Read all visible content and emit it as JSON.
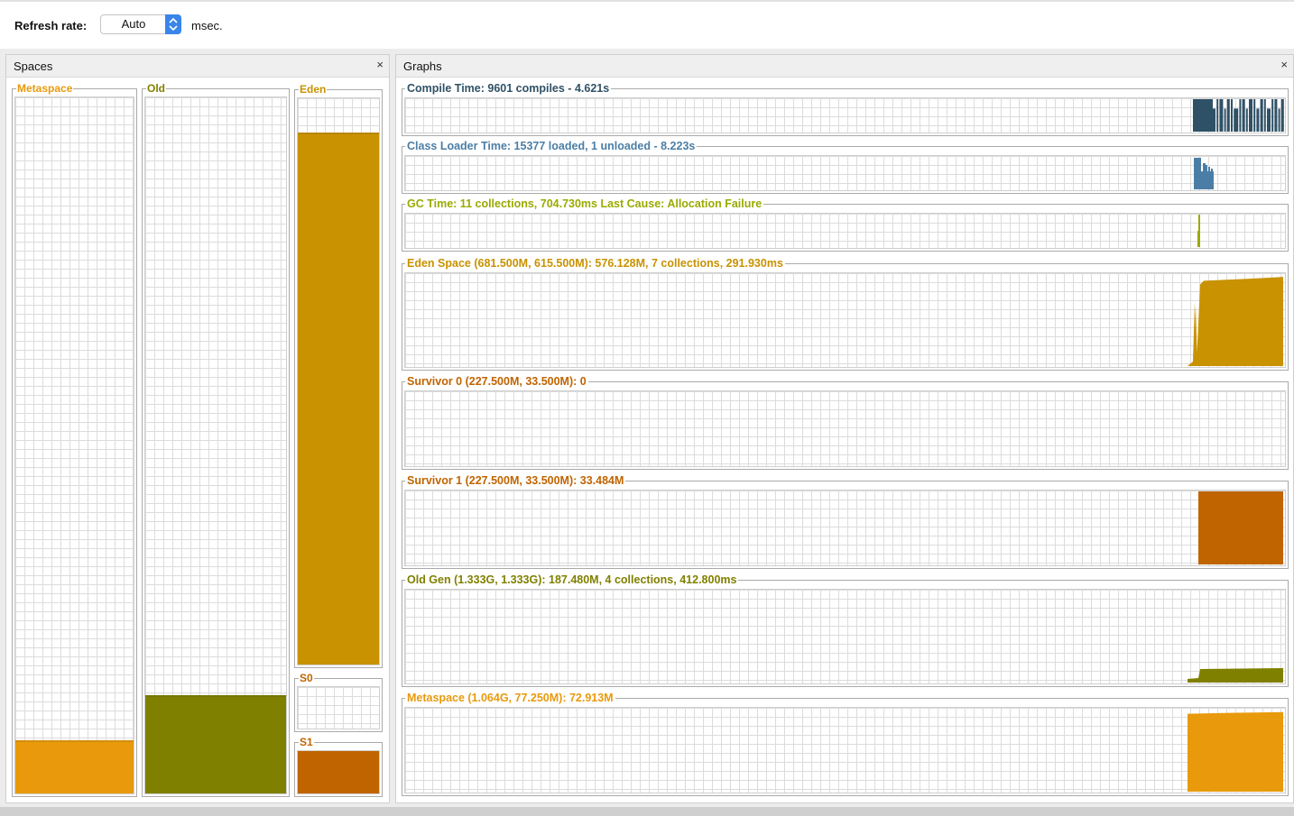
{
  "toolbar": {
    "refresh_label": "Refresh rate:",
    "refresh_value": "Auto",
    "unit_label": "msec."
  },
  "spaces_panel": {
    "title": "Spaces",
    "close_glyph": "×",
    "boxes": [
      {
        "id": "metaspace",
        "label": "Metaspace",
        "color": "#e89a0c",
        "fill_fraction": 0.074
      },
      {
        "id": "old",
        "label": "Old",
        "color": "#808000",
        "fill_fraction": 0.138
      },
      {
        "id": "eden",
        "label": "Eden",
        "color": "#c89200",
        "fill_fraction": 0.936
      },
      {
        "id": "s0",
        "label": "S0",
        "color": "#c06400",
        "fill_fraction": 0.0
      },
      {
        "id": "s1",
        "label": "S1",
        "color": "#c06400",
        "fill_fraction": 0.999
      }
    ]
  },
  "graphs_panel": {
    "title": "Graphs",
    "close_glyph": "×",
    "graphs": [
      {
        "id": "compile-time",
        "label": "Compile Time: 9601 compiles - 4.621s",
        "color": "#2f5166",
        "pattern": "compile"
      },
      {
        "id": "class-loader-time",
        "label": "Class Loader Time: 15377 loaded, 1 unloaded - 8.223s",
        "color": "#4b7ea6",
        "pattern": "classloader"
      },
      {
        "id": "gc-time",
        "label": "GC Time: 11 collections, 704.730ms Last Cause: Allocation Failure",
        "color": "#9aaa00",
        "pattern": "gc"
      },
      {
        "id": "eden-space",
        "label": "Eden Space (681.500M, 615.500M): 576.128M, 7 collections, 291.930ms",
        "color": "#c89200",
        "pattern": "eden"
      },
      {
        "id": "survivor-0",
        "label": "Survivor 0 (227.500M, 33.500M): 0",
        "color": "#c06400",
        "pattern": "empty"
      },
      {
        "id": "survivor-1",
        "label": "Survivor 1 (227.500M, 33.500M): 33.484M",
        "color": "#c06400",
        "pattern": "s1"
      },
      {
        "id": "old-gen",
        "label": "Old Gen (1.333G, 1.333G): 187.480M, 4 collections, 412.800ms",
        "color": "#808000",
        "pattern": "old"
      },
      {
        "id": "metaspace-graph",
        "label": "Metaspace (1.064G, 77.250M): 72.913M",
        "color": "#e89a0c",
        "pattern": "meta"
      }
    ]
  }
}
